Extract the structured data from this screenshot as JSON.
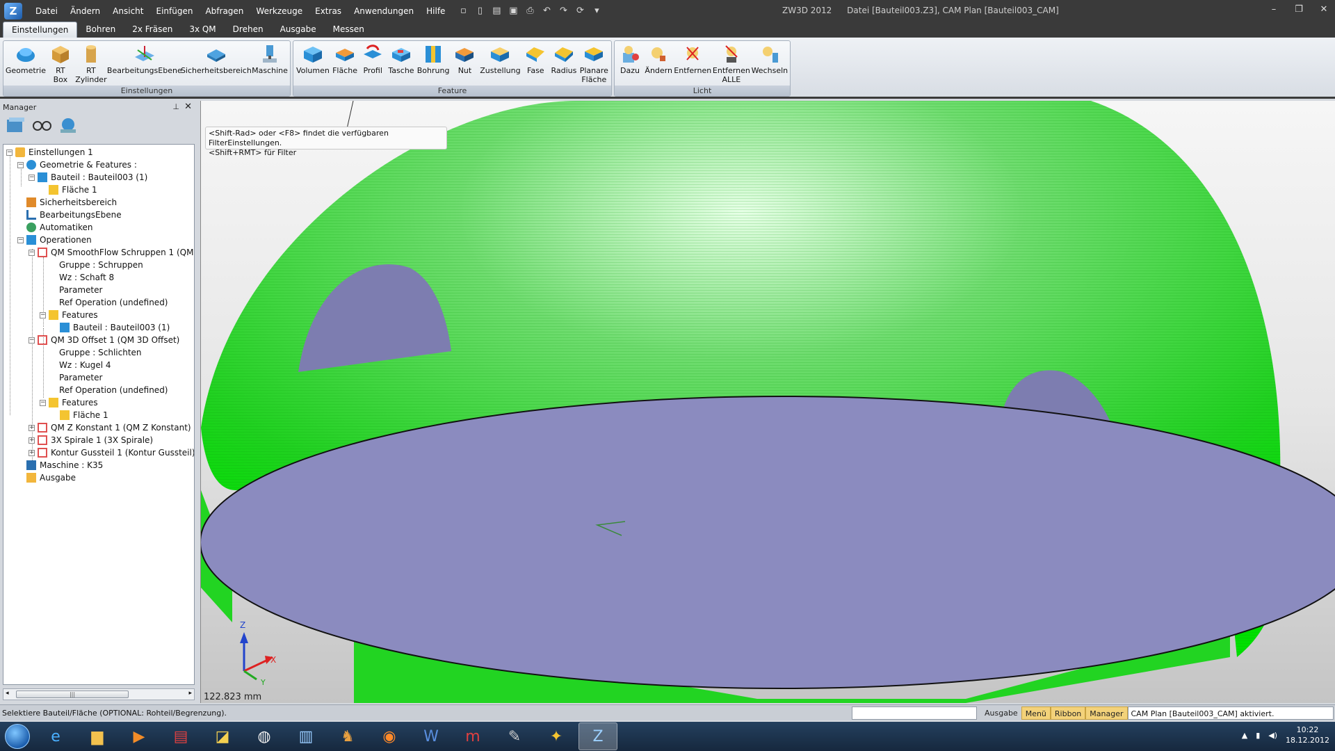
{
  "titlebar": {
    "menu": [
      "Datei",
      "Ändern",
      "Ansicht",
      "Einfügen",
      "Abfragen",
      "Werkzeuge",
      "Extras",
      "Anwendungen",
      "Hilfe"
    ],
    "app_name": "ZW3D 2012",
    "file_info": "Datei [Bauteil003.Z3],  CAM Plan [Bauteil003_CAM]"
  },
  "tabs": [
    "Einstellungen",
    "Bohren",
    "2x Fräsen",
    "3x QM",
    "Drehen",
    "Ausgabe",
    "Messen"
  ],
  "ribbon": {
    "groups": [
      {
        "label": "Einstellungen",
        "buttons": [
          "Geometrie",
          "RT\nBox",
          "RT\nZylinder",
          "BearbeitungsEbene",
          "Sicherheitsbereich",
          "Maschine"
        ]
      },
      {
        "label": "Feature",
        "buttons": [
          "Volumen",
          "Fläche",
          "Profil",
          "Tasche",
          "Bohrung",
          "Nut",
          "Zustellung",
          "Fase",
          "Radius",
          "Planare\nFläche"
        ]
      },
      {
        "label": "Licht",
        "buttons": [
          "Dazu",
          "Ändern",
          "Entfernen",
          "Entfernen\nALLE",
          "Wechseln"
        ]
      }
    ]
  },
  "manager": {
    "title": "Manager",
    "tree": [
      "Einstellungen 1",
      "Geometrie & Features :",
      "Bauteil : Bauteil003 (1)",
      "Fläche 1",
      "Sicherheitsbereich",
      "BearbeitungsEbene",
      "Automatiken",
      "Operationen",
      "QM SmoothFlow Schruppen 1 (QM S",
      "Gruppe : Schruppen",
      "Wz : Schaft 8",
      "Parameter",
      "Ref Operation (undefined)",
      "Features",
      "Bauteil : Bauteil003 (1)",
      "QM 3D Offset 1 (QM 3D Offset)",
      "Gruppe : Schlichten",
      "Wz : Kugel 4",
      "Parameter",
      "Ref Operation (undefined)",
      "Features",
      "Fläche 1",
      "QM Z Konstant 1 (QM Z Konstant)",
      "3X Spirale 1 (3X Spirale)",
      "Kontur Gussteil 1 (Kontur Gussteil)",
      "Maschine : K35",
      "Ausgabe"
    ]
  },
  "viewport": {
    "tooltip_line1": "<Shift-Rad> oder <F8> findet die verfügbaren FilterEinstellungen.",
    "tooltip_line2": "<Shift+RMT> für Filter",
    "dimension": "122.823 mm",
    "axis_z": "Z",
    "axis_x": "X",
    "axis_y": "Y",
    "colors": {
      "toolpath": "#00e000",
      "floor": "#8b8bbf"
    }
  },
  "statusbar": {
    "message": "Selektiere Bauteil/Fläche (OPTIONAL: Rohteil/Begrenzung).",
    "buttons": [
      "Ausgabe",
      "Menü",
      "Ribbon",
      "Manager"
    ],
    "note": "CAM Plan [Bauteil003_CAM] aktiviert."
  },
  "taskbar": {
    "time": "10:22",
    "date": "18.12.2012"
  }
}
